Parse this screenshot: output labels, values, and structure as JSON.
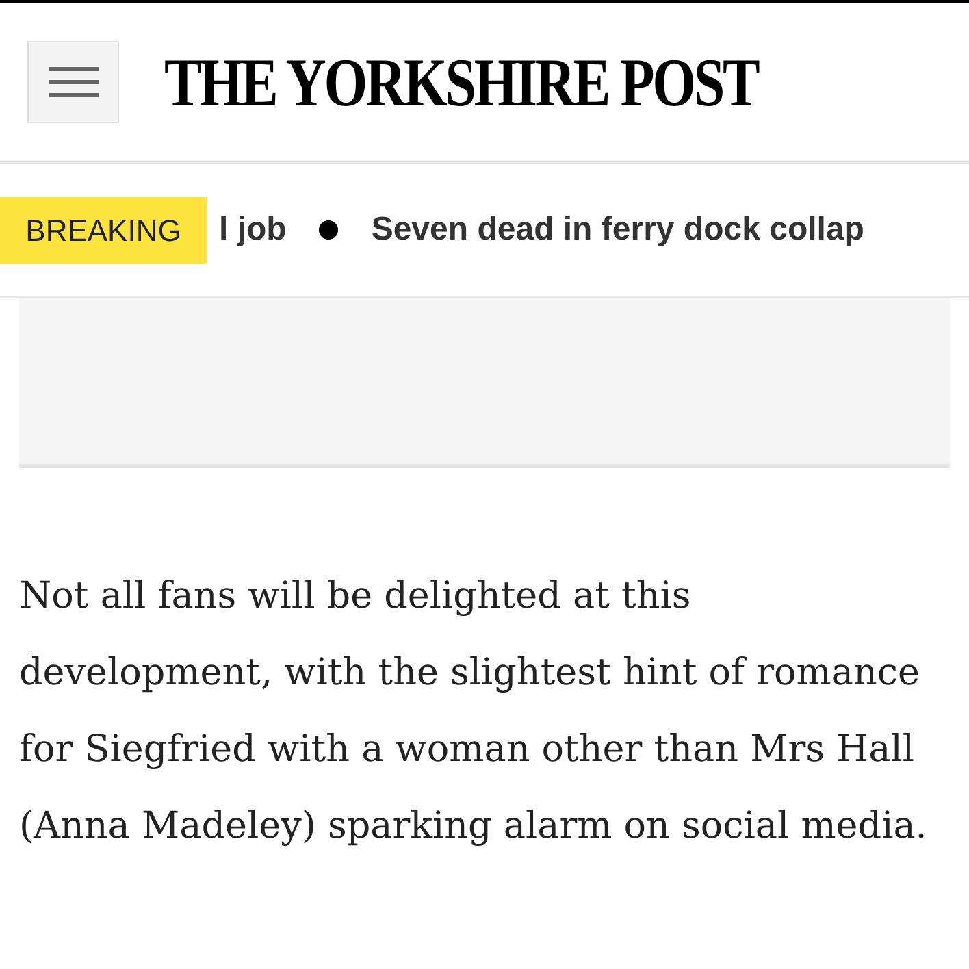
{
  "header": {
    "logo": "THE YORKSHIRE POST"
  },
  "ticker": {
    "badge": "BREAKING",
    "items": [
      "l job",
      "Seven dead in ferry dock collap"
    ]
  },
  "article": {
    "paragraph": "Not all fans will be delighted at this development, with the slightest hint of romance for Siegfried with a woman other than Mrs Hall (Anna Madeley) sparking alarm on social media."
  }
}
